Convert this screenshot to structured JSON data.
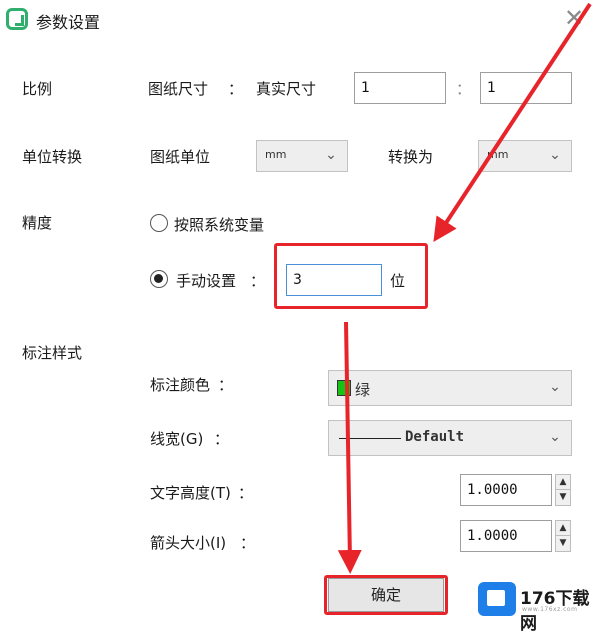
{
  "window": {
    "title": "参数设置",
    "close_glyph": "✕"
  },
  "scale": {
    "section_label": "比例",
    "drawing_size_label": "图纸尺寸",
    "colon1": "：",
    "real_size_label": "真实尺寸",
    "drawing_value": "1",
    "colon2": "：",
    "real_value": "1"
  },
  "unit": {
    "section_label": "单位转换",
    "drawing_unit_label": "图纸单位",
    "drawing_unit_value": "mm",
    "convert_to_label": "转换为",
    "convert_to_value": "mm"
  },
  "precision": {
    "section_label": "精度",
    "option_system": "按照系统变量",
    "option_manual": "手动设置",
    "manual_selected": true,
    "manual_colon": "：",
    "manual_value": "3",
    "digits_unit": "位"
  },
  "annotation": {
    "section_label": "标注样式",
    "color_label": "标注颜色",
    "color_colon": "：",
    "color_value": "绿",
    "color_hex": "#16c216",
    "linewidth_label": "线宽(G)",
    "linewidth_colon": "：",
    "linewidth_value": "Default",
    "text_height_label": "文字高度(T)",
    "text_height_colon": "：",
    "text_height_value": "1.0000",
    "arrow_size_label": "箭头大小(I)",
    "arrow_size_colon": "：",
    "arrow_size_value": "1.0000"
  },
  "actions": {
    "ok_label": "确定"
  },
  "watermark": {
    "brand": "176下载网",
    "sub": "www.176xz.com"
  },
  "annotations_overlay": {
    "highlight_color": "#e8242b"
  }
}
